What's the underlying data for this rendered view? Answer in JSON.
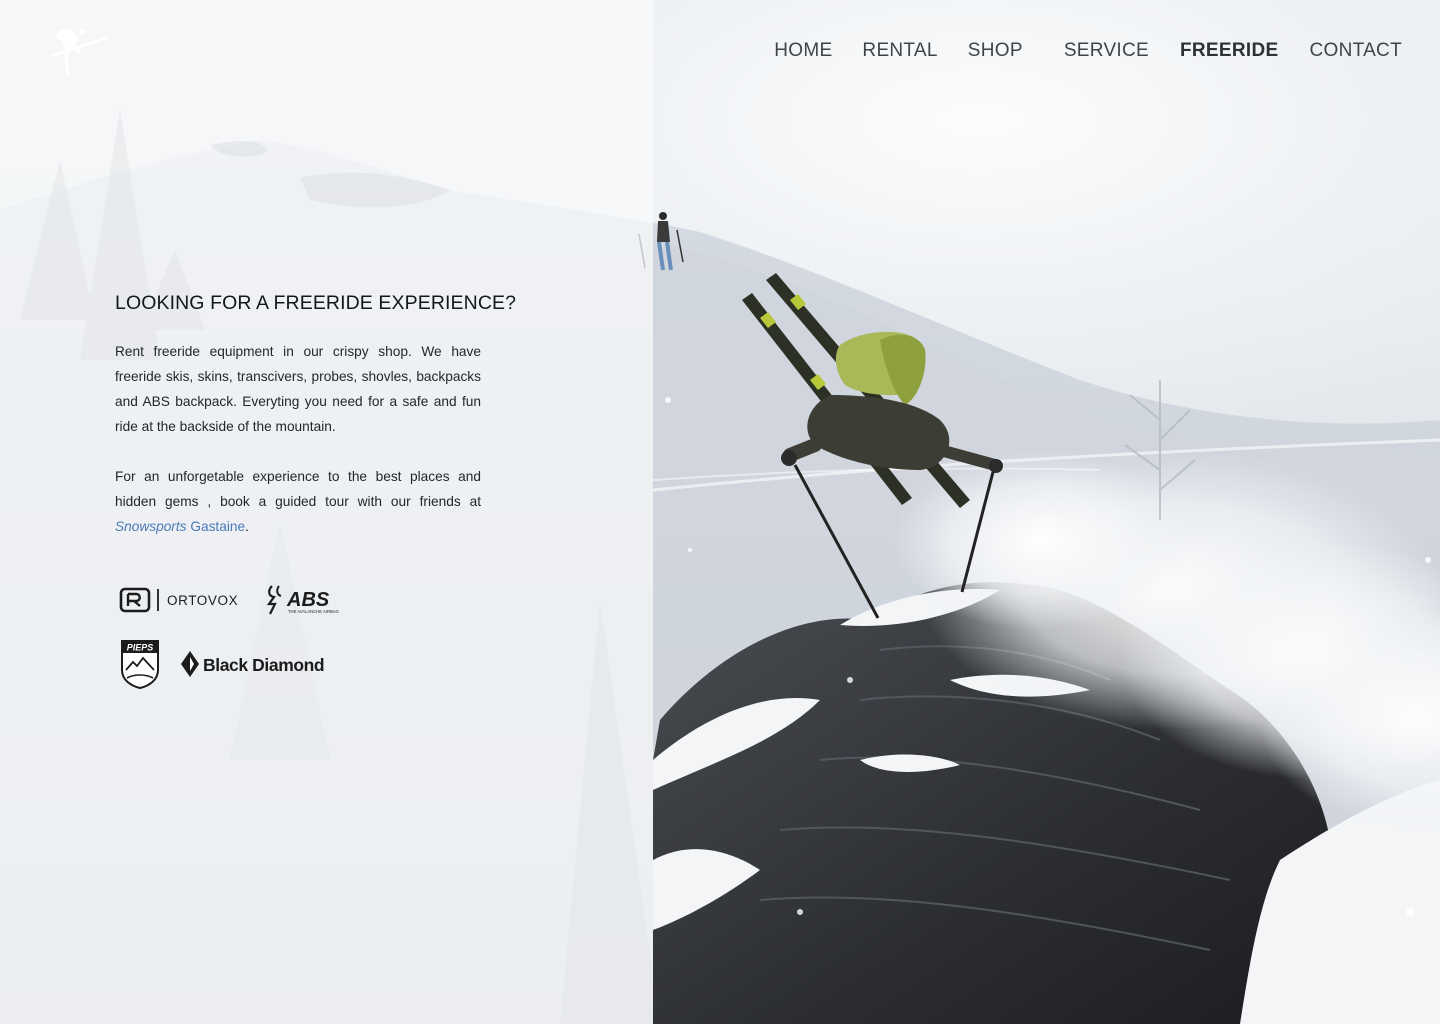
{
  "nav": {
    "items": [
      {
        "label": "HOME",
        "active": false
      },
      {
        "label": "RENTAL",
        "active": false
      },
      {
        "label": "SHOP",
        "active": false
      },
      {
        "label": "SERVICE",
        "active": false
      },
      {
        "label": "FREERIDE",
        "active": true
      },
      {
        "label": "CONTACT",
        "active": false
      }
    ]
  },
  "content": {
    "headline": "LOOKING FOR A FREERIDE EXPERIENCE?",
    "paragraph1": "Rent freeride equipment in our crispy shop. We have freeride skis, skins, transcivers, probes, shovles, backpacks and ABS backpack. Everyting you need for a safe and fun ride at the backside of the mountain.",
    "paragraph2_prefix": "For an unforgetable experience to the best places and hidden gems , book a guided tour with our friends at ",
    "link_word1": "Snowsports",
    "link_word2": " Gastaine",
    "paragraph2_suffix": "."
  },
  "brands": {
    "ortovox": "ORTOVOX",
    "abs": "ABS",
    "abs_tagline": "THE AVALANCHE AIRBAG",
    "pieps": "PIEPS",
    "black_diamond": "Black Diamond"
  },
  "colors": {
    "link": "#4a79b5",
    "nav_text": "#3f4449",
    "overlay": "rgba(248,249,251,0.74)"
  }
}
